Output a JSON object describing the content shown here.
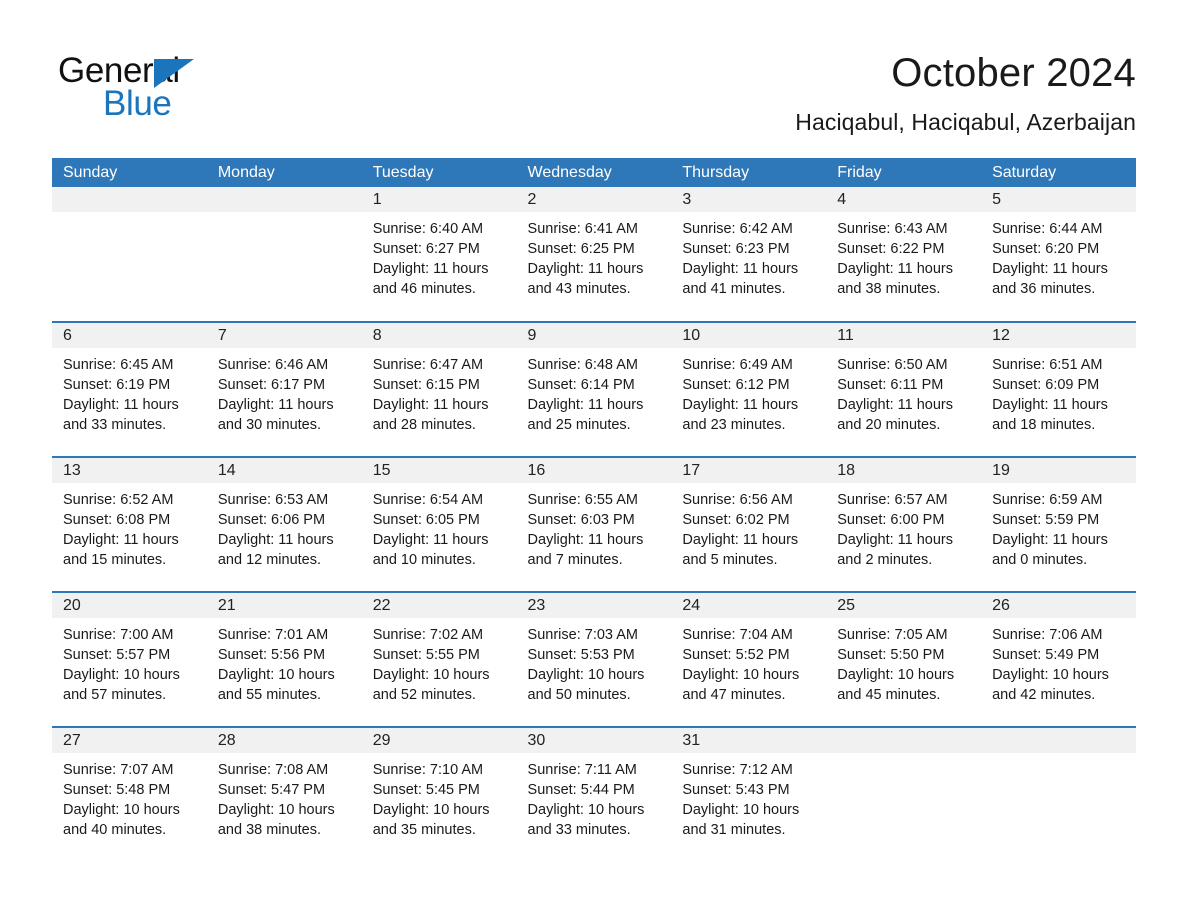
{
  "brand": {
    "name_part1": "General",
    "name_part2": "Blue",
    "triangle_color": "#1a75bc"
  },
  "header": {
    "title": "October 2024",
    "subtitle": "Haciqabul, Haciqabul, Azerbaijan",
    "header_bg_color": "#2e77b8",
    "daynum_band_color": "#f1f1f1"
  },
  "weekday_headers": [
    "Sunday",
    "Monday",
    "Tuesday",
    "Wednesday",
    "Thursday",
    "Friday",
    "Saturday"
  ],
  "weeks": [
    [
      {
        "day": "",
        "line1": "",
        "line2": "",
        "line3": "",
        "line4": ""
      },
      {
        "day": "",
        "line1": "",
        "line2": "",
        "line3": "",
        "line4": ""
      },
      {
        "day": "1",
        "line1": "Sunrise: 6:40 AM",
        "line2": "Sunset: 6:27 PM",
        "line3": "Daylight: 11 hours",
        "line4": "and 46 minutes."
      },
      {
        "day": "2",
        "line1": "Sunrise: 6:41 AM",
        "line2": "Sunset: 6:25 PM",
        "line3": "Daylight: 11 hours",
        "line4": "and 43 minutes."
      },
      {
        "day": "3",
        "line1": "Sunrise: 6:42 AM",
        "line2": "Sunset: 6:23 PM",
        "line3": "Daylight: 11 hours",
        "line4": "and 41 minutes."
      },
      {
        "day": "4",
        "line1": "Sunrise: 6:43 AM",
        "line2": "Sunset: 6:22 PM",
        "line3": "Daylight: 11 hours",
        "line4": "and 38 minutes."
      },
      {
        "day": "5",
        "line1": "Sunrise: 6:44 AM",
        "line2": "Sunset: 6:20 PM",
        "line3": "Daylight: 11 hours",
        "line4": "and 36 minutes."
      }
    ],
    [
      {
        "day": "6",
        "line1": "Sunrise: 6:45 AM",
        "line2": "Sunset: 6:19 PM",
        "line3": "Daylight: 11 hours",
        "line4": "and 33 minutes."
      },
      {
        "day": "7",
        "line1": "Sunrise: 6:46 AM",
        "line2": "Sunset: 6:17 PM",
        "line3": "Daylight: 11 hours",
        "line4": "and 30 minutes."
      },
      {
        "day": "8",
        "line1": "Sunrise: 6:47 AM",
        "line2": "Sunset: 6:15 PM",
        "line3": "Daylight: 11 hours",
        "line4": "and 28 minutes."
      },
      {
        "day": "9",
        "line1": "Sunrise: 6:48 AM",
        "line2": "Sunset: 6:14 PM",
        "line3": "Daylight: 11 hours",
        "line4": "and 25 minutes."
      },
      {
        "day": "10",
        "line1": "Sunrise: 6:49 AM",
        "line2": "Sunset: 6:12 PM",
        "line3": "Daylight: 11 hours",
        "line4": "and 23 minutes."
      },
      {
        "day": "11",
        "line1": "Sunrise: 6:50 AM",
        "line2": "Sunset: 6:11 PM",
        "line3": "Daylight: 11 hours",
        "line4": "and 20 minutes."
      },
      {
        "day": "12",
        "line1": "Sunrise: 6:51 AM",
        "line2": "Sunset: 6:09 PM",
        "line3": "Daylight: 11 hours",
        "line4": "and 18 minutes."
      }
    ],
    [
      {
        "day": "13",
        "line1": "Sunrise: 6:52 AM",
        "line2": "Sunset: 6:08 PM",
        "line3": "Daylight: 11 hours",
        "line4": "and 15 minutes."
      },
      {
        "day": "14",
        "line1": "Sunrise: 6:53 AM",
        "line2": "Sunset: 6:06 PM",
        "line3": "Daylight: 11 hours",
        "line4": "and 12 minutes."
      },
      {
        "day": "15",
        "line1": "Sunrise: 6:54 AM",
        "line2": "Sunset: 6:05 PM",
        "line3": "Daylight: 11 hours",
        "line4": "and 10 minutes."
      },
      {
        "day": "16",
        "line1": "Sunrise: 6:55 AM",
        "line2": "Sunset: 6:03 PM",
        "line3": "Daylight: 11 hours",
        "line4": "and 7 minutes."
      },
      {
        "day": "17",
        "line1": "Sunrise: 6:56 AM",
        "line2": "Sunset: 6:02 PM",
        "line3": "Daylight: 11 hours",
        "line4": "and 5 minutes."
      },
      {
        "day": "18",
        "line1": "Sunrise: 6:57 AM",
        "line2": "Sunset: 6:00 PM",
        "line3": "Daylight: 11 hours",
        "line4": "and 2 minutes."
      },
      {
        "day": "19",
        "line1": "Sunrise: 6:59 AM",
        "line2": "Sunset: 5:59 PM",
        "line3": "Daylight: 11 hours",
        "line4": "and 0 minutes."
      }
    ],
    [
      {
        "day": "20",
        "line1": "Sunrise: 7:00 AM",
        "line2": "Sunset: 5:57 PM",
        "line3": "Daylight: 10 hours",
        "line4": "and 57 minutes."
      },
      {
        "day": "21",
        "line1": "Sunrise: 7:01 AM",
        "line2": "Sunset: 5:56 PM",
        "line3": "Daylight: 10 hours",
        "line4": "and 55 minutes."
      },
      {
        "day": "22",
        "line1": "Sunrise: 7:02 AM",
        "line2": "Sunset: 5:55 PM",
        "line3": "Daylight: 10 hours",
        "line4": "and 52 minutes."
      },
      {
        "day": "23",
        "line1": "Sunrise: 7:03 AM",
        "line2": "Sunset: 5:53 PM",
        "line3": "Daylight: 10 hours",
        "line4": "and 50 minutes."
      },
      {
        "day": "24",
        "line1": "Sunrise: 7:04 AM",
        "line2": "Sunset: 5:52 PM",
        "line3": "Daylight: 10 hours",
        "line4": "and 47 minutes."
      },
      {
        "day": "25",
        "line1": "Sunrise: 7:05 AM",
        "line2": "Sunset: 5:50 PM",
        "line3": "Daylight: 10 hours",
        "line4": "and 45 minutes."
      },
      {
        "day": "26",
        "line1": "Sunrise: 7:06 AM",
        "line2": "Sunset: 5:49 PM",
        "line3": "Daylight: 10 hours",
        "line4": "and 42 minutes."
      }
    ],
    [
      {
        "day": "27",
        "line1": "Sunrise: 7:07 AM",
        "line2": "Sunset: 5:48 PM",
        "line3": "Daylight: 10 hours",
        "line4": "and 40 minutes."
      },
      {
        "day": "28",
        "line1": "Sunrise: 7:08 AM",
        "line2": "Sunset: 5:47 PM",
        "line3": "Daylight: 10 hours",
        "line4": "and 38 minutes."
      },
      {
        "day": "29",
        "line1": "Sunrise: 7:10 AM",
        "line2": "Sunset: 5:45 PM",
        "line3": "Daylight: 10 hours",
        "line4": "and 35 minutes."
      },
      {
        "day": "30",
        "line1": "Sunrise: 7:11 AM",
        "line2": "Sunset: 5:44 PM",
        "line3": "Daylight: 10 hours",
        "line4": "and 33 minutes."
      },
      {
        "day": "31",
        "line1": "Sunrise: 7:12 AM",
        "line2": "Sunset: 5:43 PM",
        "line3": "Daylight: 10 hours",
        "line4": "and 31 minutes."
      },
      {
        "day": "",
        "line1": "",
        "line2": "",
        "line3": "",
        "line4": ""
      },
      {
        "day": "",
        "line1": "",
        "line2": "",
        "line3": "",
        "line4": ""
      }
    ]
  ]
}
